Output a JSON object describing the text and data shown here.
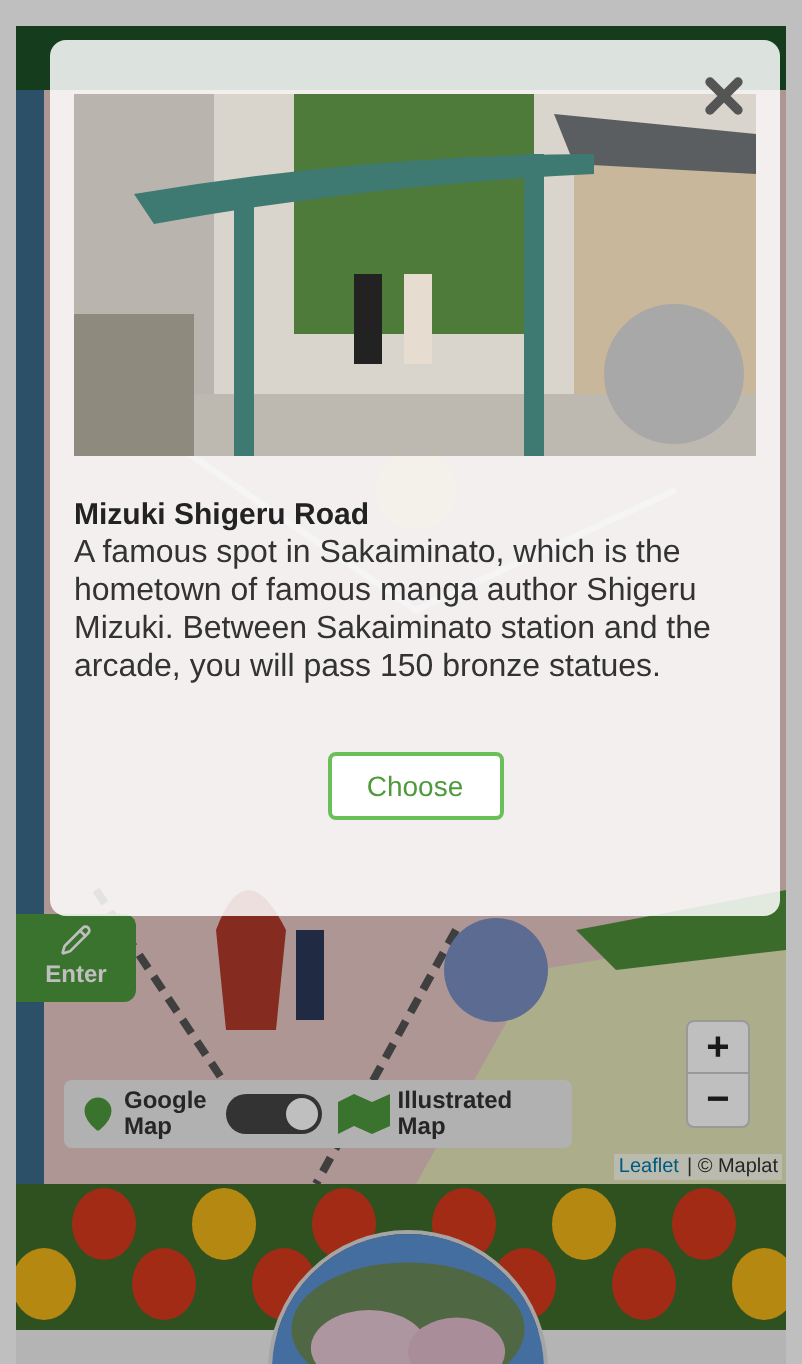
{
  "map": {
    "enter_button": "Enter",
    "layer_toggle": {
      "left_label": "Google Map",
      "right_label": "Illustrated Map",
      "on": true
    },
    "zoom_in": "+",
    "zoom_out": "−",
    "attribution": {
      "link": "Leaflet",
      "text": "| © Maplat"
    }
  },
  "modal": {
    "title": "Mizuki Shigeru Road",
    "description": "A famous spot in Sakaiminato, which is the hometown of famous manga author Shigeru Mizuki. Between Sakaiminato station and the arcade, you will pass 150 bronze statues.",
    "button": "Choose"
  }
}
